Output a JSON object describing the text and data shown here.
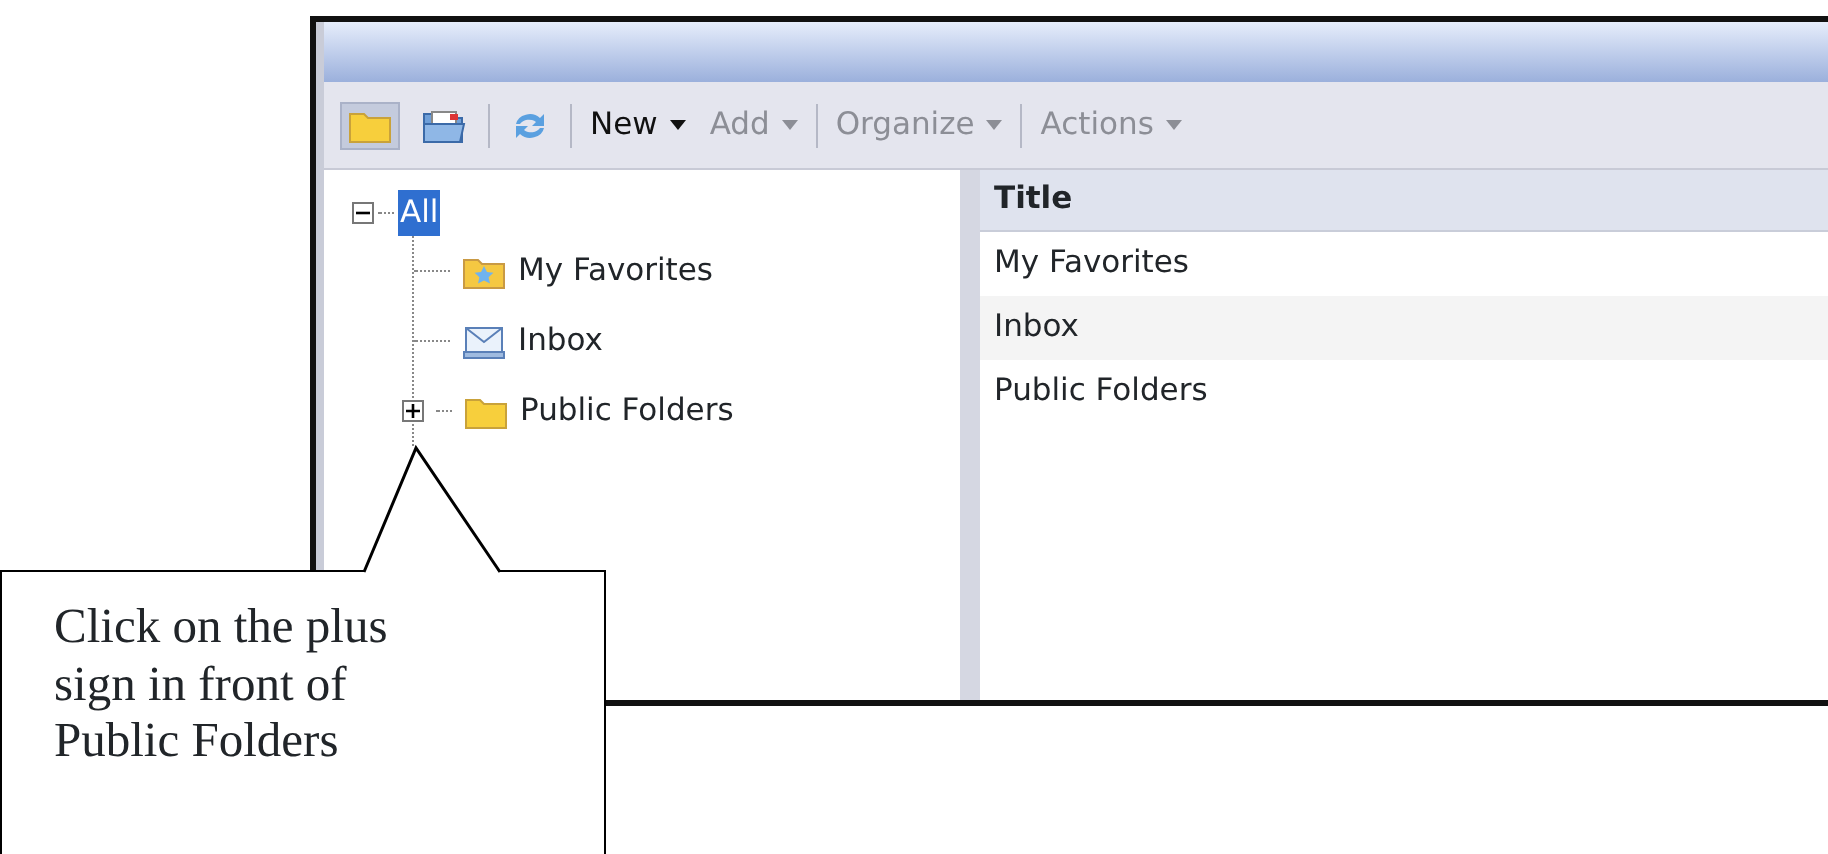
{
  "toolbar": {
    "icon_buttons": [
      {
        "kind": "folder",
        "selected": true
      },
      {
        "kind": "open-folder",
        "selected": false
      },
      {
        "kind": "refresh",
        "selected": false
      }
    ],
    "menus": [
      {
        "label": "New",
        "disabled": false
      },
      {
        "label": "Add",
        "disabled": true
      },
      {
        "label": "Organize",
        "disabled": true
      },
      {
        "label": "Actions",
        "disabled": true
      }
    ]
  },
  "tree": {
    "label": "All",
    "expanded": true,
    "selected": true,
    "children": [
      {
        "label": "My Favorites",
        "kind": "favorites"
      },
      {
        "label": "Inbox",
        "kind": "inbox"
      },
      {
        "label": "Public Folders",
        "kind": "folder",
        "expanded": false
      }
    ]
  },
  "table": {
    "columns": [
      "Title"
    ],
    "rows": [
      {
        "title": "My Favorites"
      },
      {
        "title": "Inbox"
      },
      {
        "title": "Public Folders"
      }
    ]
  },
  "callout": {
    "text": "Click on the plus sign in front of Public Folders"
  }
}
